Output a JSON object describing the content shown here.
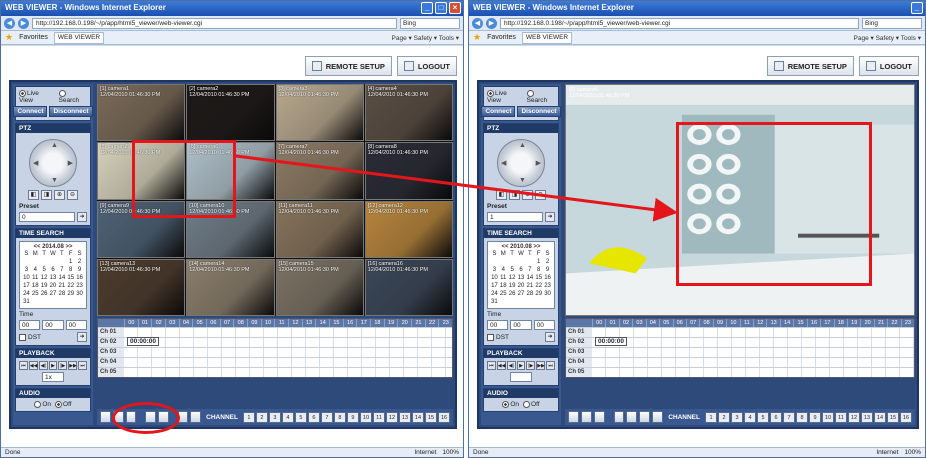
{
  "browser": {
    "window_title": "WEB VIEWER - Windows Internet Explorer",
    "url": "http://192.168.0.198/~/p/app/html5_viewer/web-viewer.cgi",
    "search_engine": "Bing",
    "favorites_label": "Favorites",
    "tab_label": "WEB VIEWER",
    "tools_text": "Page ▾  Safety ▾  Tools ▾",
    "status_left": "Done",
    "status_zone": "Internet",
    "status_zoom": "100%"
  },
  "header": {
    "remote_setup": "REMOTE SETUP",
    "logout": "LOGOUT"
  },
  "sidebar": {
    "live_view": "Live View",
    "search": "Search",
    "connect": "Connect",
    "disconnect": "Disconnect",
    "ptz_title": "PTZ",
    "preset_title": "Preset",
    "preset_value_left": "0",
    "preset_value_right": "1",
    "time_search_title": "TIME SEARCH",
    "cal_header_left": "<< 2014.08 >>",
    "cal_header_right": "<< 2010.08 >>",
    "weekdays": [
      "S",
      "M",
      "T",
      "W",
      "T",
      "F",
      "S"
    ],
    "time_title": "Time",
    "time_h": "00",
    "time_m": "00",
    "time_s": "00",
    "dst": "DST",
    "playback_title": "PLAYBACK",
    "playback_speed": "1x",
    "audio_title": "AUDIO",
    "audio_on": "On",
    "audio_off": "Off"
  },
  "cameras": [
    {
      "id": "[1] camera1",
      "ts": "12/04/2010 01:46:30 PM",
      "bg": "#7a6a58"
    },
    {
      "id": "[2] camera2",
      "ts": "12/04/2010 01:46:30 PM",
      "bg": "#1d1a18"
    },
    {
      "id": "[3] camera3",
      "ts": "12/04/2010 01:46:30 PM",
      "bg": "#b8a88e"
    },
    {
      "id": "[4] camera4",
      "ts": "12/04/2010 01:46:30 PM",
      "bg": "#5a4e44"
    },
    {
      "id": "[5] camera5",
      "ts": "12/04/2010 01:46:30 PM",
      "bg": "#d6d1bb"
    },
    {
      "id": "[6] camera6",
      "ts": "12/04/2010 01:46:30 PM",
      "bg": "#aebfc8"
    },
    {
      "id": "[7] camera7",
      "ts": "12/04/2010 01:46:30 PM",
      "bg": "#8c7a64"
    },
    {
      "id": "[8] camera8",
      "ts": "12/04/2010 01:46:30 PM",
      "bg": "#2a2c36"
    },
    {
      "id": "[9] camera9",
      "ts": "12/04/2010 01:46:30 PM",
      "bg": "#4e6276"
    },
    {
      "id": "[10] camera10",
      "ts": "12/04/2010 01:46:30 PM",
      "bg": "#6f7c87"
    },
    {
      "id": "[11] camera11",
      "ts": "12/04/2010 01:46:30 PM",
      "bg": "#86735b"
    },
    {
      "id": "[12] camera12",
      "ts": "12/04/2010 01:46:30 PM",
      "bg": "#b7853d"
    },
    {
      "id": "[13] camera13",
      "ts": "12/04/2010 01:46:30 PM",
      "bg": "#4d3c2e"
    },
    {
      "id": "[14] camera14",
      "ts": "12/04/2010 01:46:30 PM",
      "bg": "#8a7e6c"
    },
    {
      "id": "[15] camera15",
      "ts": "12/04/2010 01:46:30 PM",
      "bg": "#7b7263"
    },
    {
      "id": "[16] camera16",
      "ts": "12/04/2010 01:46:30 PM",
      "bg": "#3b4758"
    }
  ],
  "single_view": {
    "id": "[6] camera6",
    "ts": "12/04/2010 01:46:30 PM"
  },
  "timeline": {
    "hours": [
      "00",
      "01",
      "02",
      "03",
      "04",
      "05",
      "06",
      "07",
      "08",
      "09",
      "10",
      "11",
      "12",
      "13",
      "14",
      "15",
      "16",
      "17",
      "18",
      "19",
      "20",
      "21",
      "22",
      "23"
    ],
    "channels": [
      "Ch 01",
      "Ch 02",
      "Ch 03",
      "Ch 04",
      "Ch 05"
    ],
    "current_time": "00:00:00"
  },
  "bottom": {
    "channel_label": "CHANNEL",
    "channels": [
      "1",
      "2",
      "3",
      "4",
      "5",
      "6",
      "7",
      "8",
      "9",
      "10",
      "11",
      "12",
      "13",
      "14",
      "15",
      "16"
    ]
  },
  "colors": {
    "annotation": "#e5161b",
    "panel": "#3a5890",
    "titlebar": "#1b4fb0"
  }
}
